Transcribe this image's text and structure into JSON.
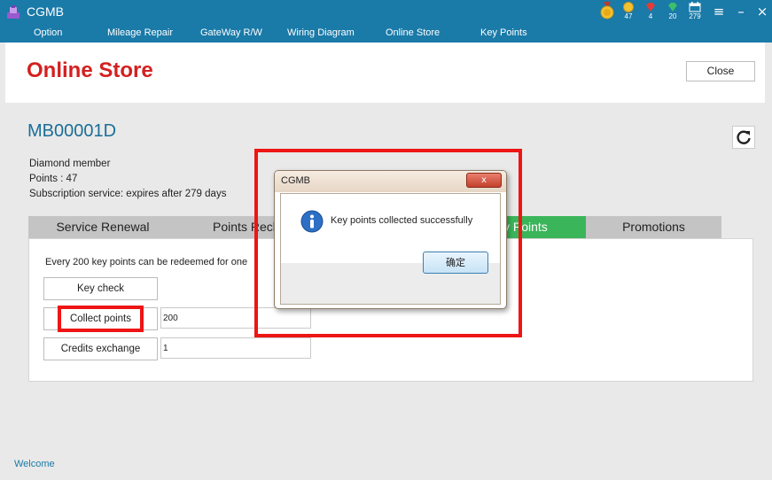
{
  "titlebar": {
    "app_title": "CGMB",
    "stats": [
      {
        "icon": "gold-medal-icon",
        "value": ""
      },
      {
        "icon": "gold-coin-icon",
        "value": "47"
      },
      {
        "icon": "red-gem-icon",
        "value": "4"
      },
      {
        "icon": "green-gem-icon",
        "value": "20"
      },
      {
        "icon": "calendar-icon",
        "value": "279"
      }
    ],
    "menu_glyph": "≡",
    "minimize_glyph": "–",
    "close_glyph": "×"
  },
  "menu": {
    "items": [
      "Option",
      "Mileage Repair",
      "GateWay R/W",
      "Wiring Diagram",
      "Online Store",
      "Key Points"
    ]
  },
  "header": {
    "title": "Online Store",
    "close_label": "Close"
  },
  "account": {
    "id": "MB00001D",
    "membership": "Diamond member",
    "points": "Points : 47",
    "subscription": "Subscription service: expires after 279 days"
  },
  "tabs": [
    {
      "label": "Service Renewal",
      "active": false
    },
    {
      "label": "Points Rechar",
      "active": false
    },
    {
      "label": "y Points",
      "active": true
    },
    {
      "label": "Promotions",
      "active": false
    }
  ],
  "panel": {
    "description": "Every 200 key points can be redeemed for one",
    "key_check_label": "Key check",
    "collect_points_label": "Collect points",
    "collect_points_value": "200",
    "credits_exchange_label": "Credits exchange",
    "credits_exchange_value": "1"
  },
  "dialog": {
    "title": "CGMB",
    "close_glyph": "x",
    "message": "Key points collected successfully",
    "ok_label": "确定",
    "icon": "info-icon"
  },
  "status": {
    "text": "Welcome"
  },
  "colors": {
    "titlebar": "#1a7aa8",
    "brand_red": "#d42020",
    "active_tab": "#3bb55a",
    "highlight": "#ee1515"
  }
}
